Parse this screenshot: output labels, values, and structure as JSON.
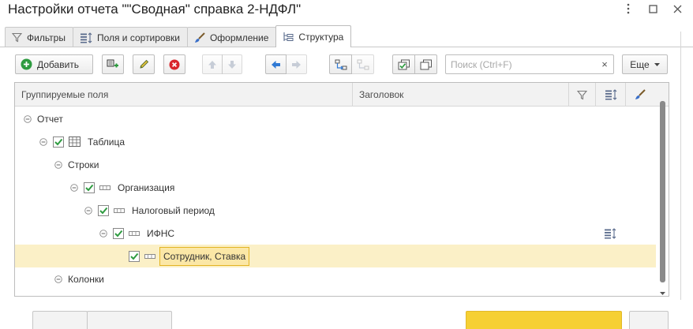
{
  "window": {
    "title": "Настройки отчета \"\"Сводная\" справка 2-НДФЛ\"",
    "menu_icon": "more-vertical-icon",
    "maximize_icon": "maximize-icon",
    "close_icon": "close-icon"
  },
  "tabs": [
    {
      "label": "Фильтры",
      "icon": "filter-icon"
    },
    {
      "label": "Поля и сортировки",
      "icon": "fields-sort-icon"
    },
    {
      "label": "Оформление",
      "icon": "brush-icon"
    },
    {
      "label": "Структура",
      "icon": "structure-icon",
      "active": true
    }
  ],
  "toolbar": {
    "add_label": "Добавить",
    "search_placeholder": "Поиск (Ctrl+F)",
    "search_value": "",
    "search_clear": "×",
    "more_label": "Еще"
  },
  "grid": {
    "columns": {
      "fields": "Группируемые поля",
      "header": "Заголовок"
    },
    "rows": [
      {
        "label": "Отчет",
        "level": 0,
        "toggle": "⊖",
        "checkbox": false,
        "icon": "none"
      },
      {
        "label": "Таблица",
        "level": 1,
        "toggle": "⊖",
        "checkbox": true,
        "icon": "table-icon"
      },
      {
        "label": "Строки",
        "level": 2,
        "toggle": "⊖",
        "checkbox": false,
        "icon": "none"
      },
      {
        "label": "Организация",
        "level": 3,
        "toggle": "⊖",
        "checkbox": true,
        "icon": "field-icon"
      },
      {
        "label": "Налоговый период",
        "level": 4,
        "toggle": "⊖",
        "checkbox": true,
        "icon": "field-icon"
      },
      {
        "label": "ИФНС",
        "level": 5,
        "toggle": "⊖",
        "checkbox": true,
        "icon": "field-icon",
        "sort_icon": true
      },
      {
        "label": "Сотрудник, Ставка",
        "level": 6,
        "toggle": "",
        "checkbox": true,
        "icon": "field-icon",
        "selected": true
      },
      {
        "label": "Колонки",
        "level": 2,
        "toggle": "⊖",
        "checkbox": false,
        "icon": "none"
      }
    ]
  },
  "colors": {
    "accent_green": "#2e9b40",
    "selection_bg": "#fbf0c7",
    "edit_border": "#e3b423",
    "primary_button": "#f6d033"
  }
}
